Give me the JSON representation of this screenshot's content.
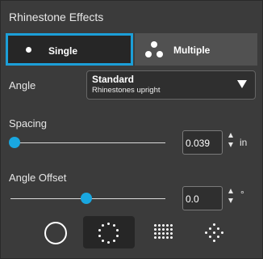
{
  "panel": {
    "title": "Rhinestone Effects"
  },
  "mode": {
    "single_label": "Single",
    "multiple_label": "Multiple",
    "selected": "Single"
  },
  "angle": {
    "label": "Angle",
    "dropdown_value": "Standard",
    "dropdown_subtitle": "Rhinestones upright"
  },
  "spacing": {
    "label": "Spacing",
    "value": "0.039",
    "unit": "in",
    "slider_fraction": 0.0
  },
  "angle_offset": {
    "label": "Angle Offset",
    "value": "0.0",
    "unit": "°",
    "slider_fraction": 0.5
  },
  "shape_options": [
    {
      "icon": "empty-circle-icon"
    },
    {
      "icon": "dotted-circle-icon",
      "selected": true
    },
    {
      "icon": "dot-grid-icon"
    },
    {
      "icon": "dot-diamond-icon"
    }
  ],
  "colors": {
    "accent": "#1c9fd8",
    "panel_bg": "#3b3b3b",
    "selected_bg": "#262626"
  }
}
